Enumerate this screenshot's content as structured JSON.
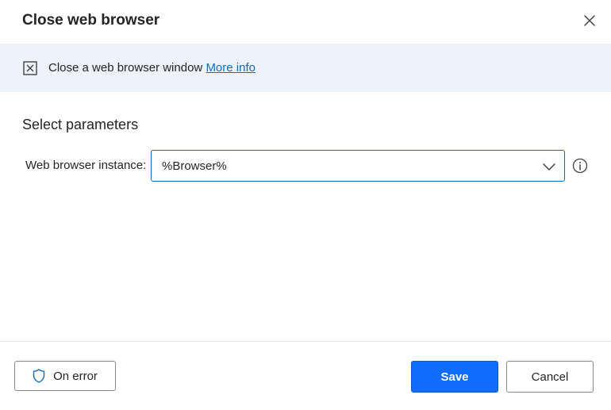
{
  "dialog": {
    "title": "Close web browser",
    "close_icon": "close-icon"
  },
  "banner": {
    "icon": "close-window-icon",
    "text": "Close a web browser window",
    "link_text": "More info"
  },
  "parameters": {
    "section_title": "Select parameters",
    "browser_instance": {
      "label": "Web browser instance:",
      "value": "%Browser%",
      "chevron_icon": "chevron-down-icon",
      "info_icon": "info-icon"
    }
  },
  "footer": {
    "on_error_label": "On error",
    "on_error_icon": "shield-icon",
    "save_label": "Save",
    "cancel_label": "Cancel"
  },
  "colors": {
    "accent": "#0f6cfd",
    "banner_bg": "#eef3fb",
    "link": "#0f6cbd"
  }
}
